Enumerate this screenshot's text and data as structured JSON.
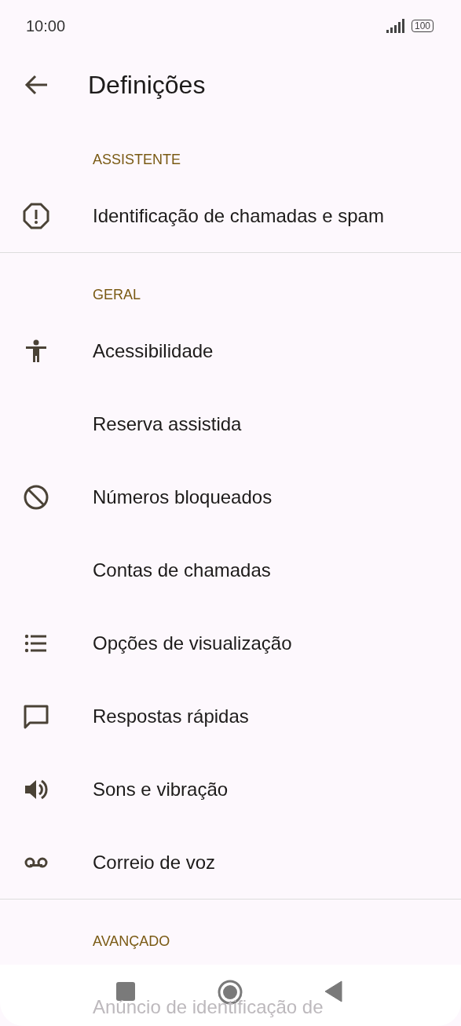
{
  "status_bar": {
    "time": "10:00",
    "battery": "100"
  },
  "toolbar": {
    "title": "Definições"
  },
  "sections": [
    {
      "header": "ASSISTENTE",
      "items": [
        {
          "label": "Identificação de chamadas e spam",
          "kind": "alert"
        }
      ]
    },
    {
      "header": "GERAL",
      "items": [
        {
          "label": "Acessibilidade",
          "kind": "accessibility"
        },
        {
          "label": "Reserva assistida",
          "kind": "plain"
        },
        {
          "label": "Números bloqueados",
          "kind": "block"
        },
        {
          "label": "Contas de chamadas",
          "kind": "plain"
        },
        {
          "label": "Opções de visualização",
          "kind": "list"
        },
        {
          "label": "Respostas rápidas",
          "kind": "message"
        },
        {
          "label": "Sons e vibração",
          "kind": "sound"
        },
        {
          "label": "Correio de voz",
          "kind": "voicemail"
        }
      ]
    },
    {
      "header": "AVANÇADO",
      "items": [
        {
          "label": "Anúncio de identificação de",
          "kind": "plain"
        }
      ]
    }
  ]
}
